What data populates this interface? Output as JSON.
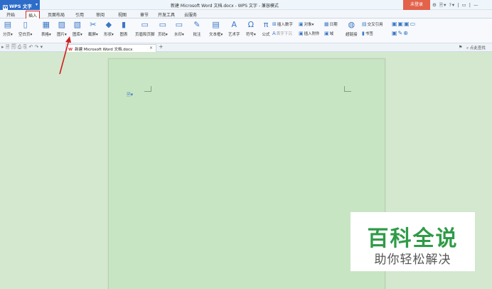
{
  "titlebar": {
    "app_name": "WPS 文字",
    "app_dropdown": "▾",
    "window_title": "新建 Microsoft Word 文档.docx - WPS 文字 - 兼容模式",
    "login_button": "未登录",
    "controls": "⚙ 🖹▾ ?▾ | ▭ | —"
  },
  "tabs": [
    "开始",
    "插入",
    "页面布局",
    "引用",
    "审阅",
    "视图",
    "章节",
    "开发工具",
    "云服务"
  ],
  "active_tab": "插入",
  "ribbon": {
    "buttons": [
      {
        "label": "分页▾",
        "icon": "page-break-icon",
        "glyph": "▤"
      },
      {
        "label": "空白页▾",
        "icon": "blank-page-icon",
        "glyph": "▯"
      },
      {
        "label": "表格▾",
        "icon": "table-icon",
        "glyph": "▦"
      },
      {
        "label": "图片▾",
        "icon": "picture-icon",
        "glyph": "▨"
      },
      {
        "label": "图库▾",
        "icon": "gallery-icon",
        "glyph": "▧"
      },
      {
        "label": "截屏▾",
        "icon": "screenshot-icon",
        "glyph": "✂"
      },
      {
        "label": "形状▾",
        "icon": "shapes-icon",
        "glyph": "◆"
      },
      {
        "label": "图表",
        "icon": "chart-icon",
        "glyph": "▮"
      },
      {
        "label": "页眉和页脚",
        "icon": "header-footer-icon",
        "glyph": "▭"
      },
      {
        "label": "页码▾",
        "icon": "page-number-icon",
        "glyph": "▭"
      },
      {
        "label": "水印▾",
        "icon": "watermark-icon",
        "glyph": "▭"
      },
      {
        "label": "批注",
        "icon": "comment-icon",
        "glyph": "✎"
      },
      {
        "label": "文本框▾",
        "icon": "textbox-icon",
        "glyph": "▤"
      },
      {
        "label": "艺术字",
        "icon": "wordart-icon",
        "glyph": "A"
      },
      {
        "label": "符号▾",
        "icon": "symbol-icon",
        "glyph": "Ω"
      },
      {
        "label": "公式",
        "icon": "formula-icon",
        "glyph": "π"
      },
      {
        "label": "超链接",
        "icon": "hyperlink-icon",
        "glyph": "◍"
      }
    ],
    "small_items": [
      {
        "label": "插入数字",
        "icon": "insert-number-icon",
        "glyph": "⊞",
        "dim": false
      },
      {
        "label": "对象▾",
        "icon": "object-icon",
        "glyph": "▣",
        "dim": false
      },
      {
        "label": "日期",
        "icon": "date-icon",
        "glyph": "▦",
        "dim": false
      },
      {
        "label": "首字下沉",
        "icon": "drop-cap-icon",
        "glyph": "A",
        "dim": true
      },
      {
        "label": "插入附件",
        "icon": "attachment-icon",
        "glyph": "▣",
        "dim": false
      },
      {
        "label": "域",
        "icon": "field-icon",
        "glyph": "▣",
        "dim": false
      },
      {
        "label": "交叉引用",
        "icon": "cross-reference-icon",
        "glyph": "▤",
        "dim": false
      },
      {
        "label": "书签",
        "icon": "bookmark-icon",
        "glyph": "▮",
        "dim": false
      }
    ]
  },
  "quick_access": "▸ 🗎 🗐 ⎙ ⎘ ↶ ↷ ▾",
  "doc_tab": {
    "icon": "W",
    "label": "新建 Microsoft Word 文档.docx",
    "close": "×",
    "new_tab": "+"
  },
  "search": {
    "label": "点此查找"
  },
  "watermark": {
    "main": "百科全说",
    "sub": "助你轻松解决"
  },
  "colors": {
    "accent": "#2d6cc9",
    "arrow": "#d21e1e",
    "login": "#e2624a",
    "watermark_green": "#2f9b47",
    "page_green": "#c8e5c3"
  }
}
